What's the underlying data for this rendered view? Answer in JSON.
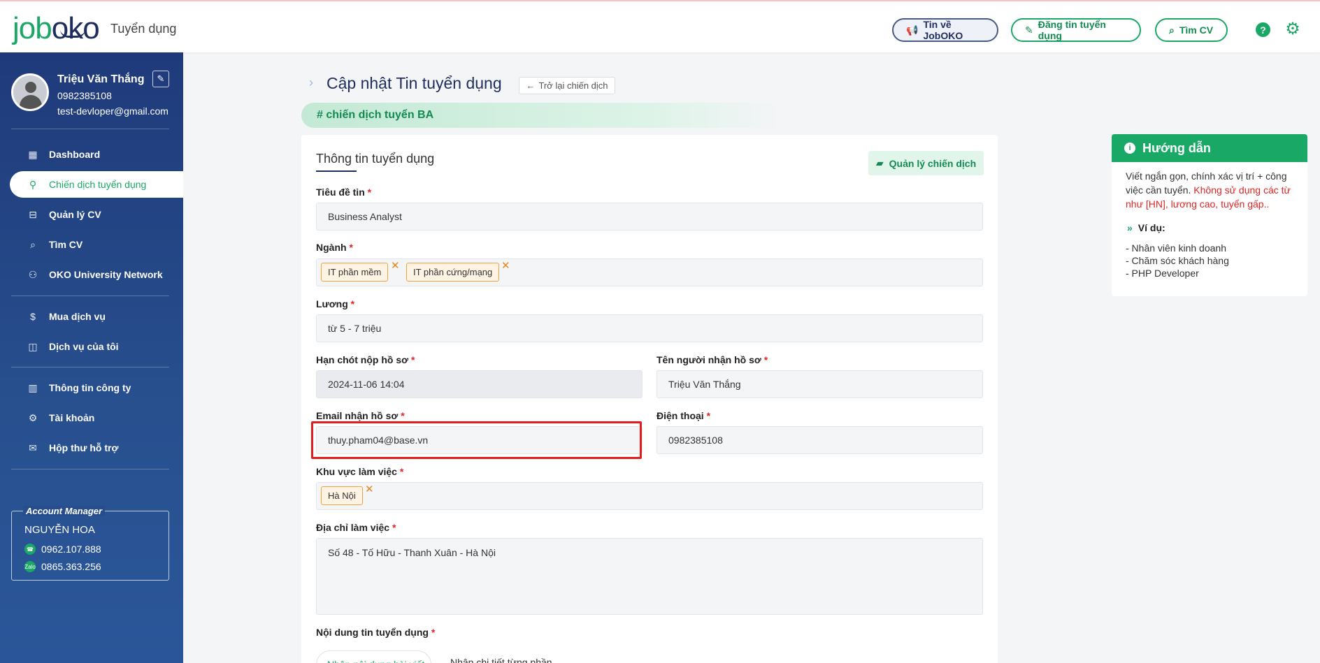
{
  "header": {
    "logo_job": "job",
    "logo_oko": "oko",
    "logo_sub": "Tuyển dụng",
    "btn_news": "Tin về JobOKO",
    "btn_post": "Đăng tin tuyển dụng",
    "btn_cv": "Tìm CV"
  },
  "profile": {
    "name": "Triệu Văn Thắng",
    "phone": "0982385108",
    "email": "test-devloper@gmail.com"
  },
  "nav": [
    {
      "label": "Dashboard",
      "icon": "grid-icon"
    },
    {
      "label": "Chiến dịch tuyển dụng",
      "icon": "user-search-icon"
    },
    {
      "label": "Quản lý CV",
      "icon": "inbox-icon"
    },
    {
      "label": "Tìm CV",
      "icon": "search-icon"
    },
    {
      "label": "OKO University Network",
      "icon": "network-icon"
    },
    {
      "label": "Mua dịch vụ",
      "icon": "money-bag-icon"
    },
    {
      "label": "Dịch vụ của tôi",
      "icon": "service-icon"
    },
    {
      "label": "Thông tin công ty",
      "icon": "building-icon"
    },
    {
      "label": "Tài khoản",
      "icon": "gear-icon"
    },
    {
      "label": "Hộp thư hỗ trợ",
      "icon": "mail-icon"
    }
  ],
  "account_manager": {
    "title": "Account Manager",
    "name": "NGUYỄN HOA",
    "phone": "0962.107.888",
    "zalo": "0865.363.256",
    "zalo_badge": "Zalo"
  },
  "page": {
    "title": "Cập nhật Tin tuyển dụng",
    "back": "Trở lại chiến dịch",
    "campaign": "# chiến dịch tuyển BA"
  },
  "form": {
    "card_title": "Thông tin tuyển dụng",
    "manage_btn": "Quản lý chiến dịch",
    "title_label": "Tiêu đề tin",
    "title_value": "Business Analyst",
    "industry_label": "Ngành",
    "industries": [
      "IT phần mềm",
      "IT phần cứng/mạng"
    ],
    "salary_label": "Lương",
    "salary_value": "từ 5 - 7 triệu",
    "deadline_label": "Hạn chót nộp hồ sơ",
    "deadline_value": "2024-11-06 14:04",
    "receiver_label": "Tên người nhận hồ sơ",
    "receiver_value": "Triệu Văn Thắng",
    "email_label": "Email nhận hồ sơ",
    "email_value": "thuy.pham04@base.vn",
    "phone_label": "Điện thoại",
    "phone_value": "0982385108",
    "area_label": "Khu vực làm việc",
    "areas": [
      "Hà Nội"
    ],
    "address_label": "Địa chỉ làm việc",
    "address_value": "Số 48 - Tố Hữu - Thanh Xuân - Hà Nội",
    "content_label": "Nội dung tin tuyển dụng",
    "tab_full": "Nhập nội dung bài viết",
    "tab_parts": "Nhập chi tiết từng phần",
    "required_mark": "*"
  },
  "guide": {
    "title": "Hướng dẫn",
    "text": "Viết ngắn gọn, chính xác vị trí + công việc cần tuyển.",
    "warn": "Không sử dụng các từ như [HN], lương cao, tuyển gấp..",
    "example_title": "Ví dụ:",
    "examples": [
      "- Nhân viên kinh doanh",
      "- Chăm sóc khách hàng",
      "- PHP Developer"
    ]
  }
}
